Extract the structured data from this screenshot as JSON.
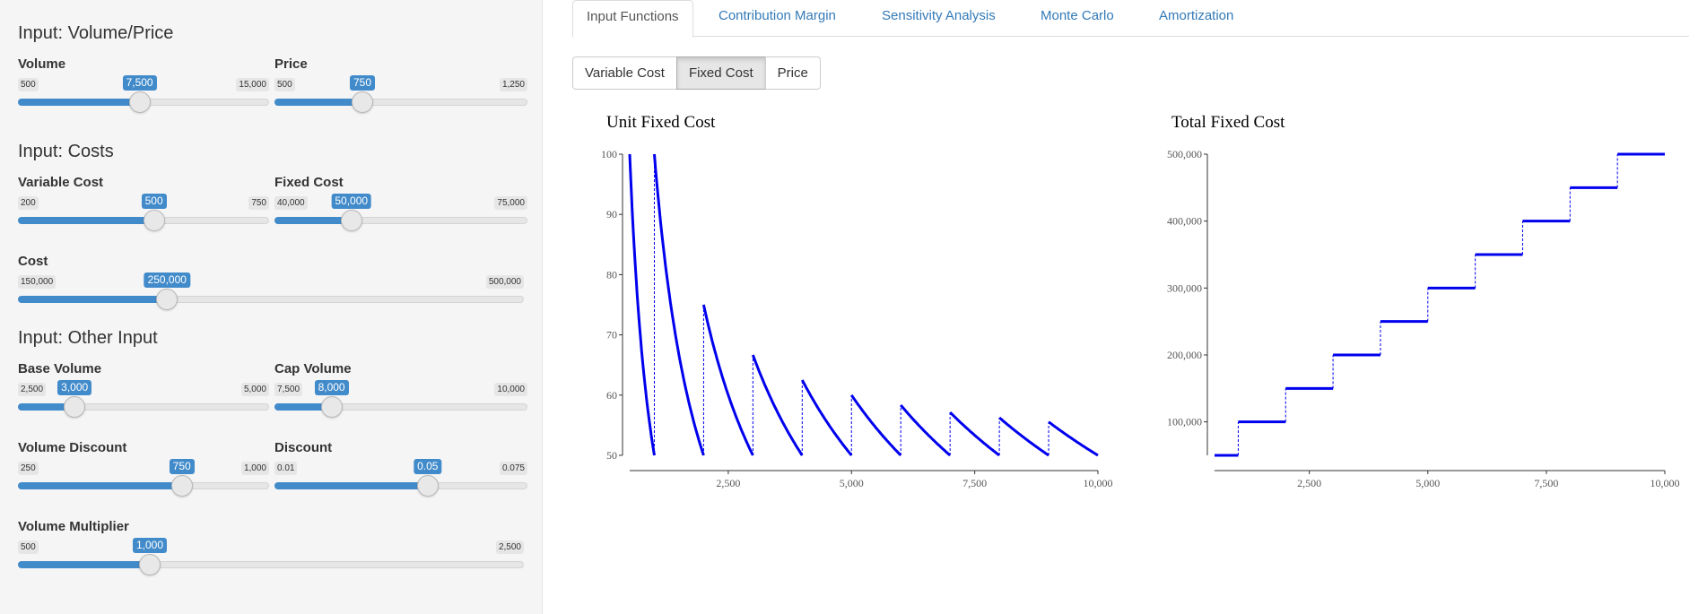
{
  "sidebar": {
    "sections": [
      {
        "title": "Input: Volume/Price"
      },
      {
        "title": "Input: Costs"
      },
      {
        "title": "Input: Other Input"
      }
    ],
    "sliders": [
      {
        "label": "Volume",
        "min_label": "500",
        "max_label": "15,000",
        "value_label": "7,500",
        "fraction": 0.4828
      },
      {
        "label": "Price",
        "min_label": "500",
        "max_label": "1,250",
        "value_label": "750",
        "fraction": 0.3333
      },
      {
        "label": "Variable Cost",
        "min_label": "200",
        "max_label": "750",
        "value_label": "500",
        "fraction": 0.5455
      },
      {
        "label": "Fixed Cost",
        "min_label": "40,000",
        "max_label": "75,000",
        "value_label": "50,000",
        "fraction": 0.2857
      },
      {
        "label": "Cost",
        "min_label": "150,000",
        "max_label": "500,000",
        "value_label": "250,000",
        "fraction": 0.2857
      },
      {
        "label": "Base Volume",
        "min_label": "2,500",
        "max_label": "5,000",
        "value_label": "3,000",
        "fraction": 0.2
      },
      {
        "label": "Cap Volume",
        "min_label": "7,500",
        "max_label": "10,000",
        "value_label": "8,000",
        "fraction": 0.2
      },
      {
        "label": "Volume Discount",
        "min_label": "250",
        "max_label": "1,000",
        "value_label": "750",
        "fraction": 0.6667
      },
      {
        "label": "Discount",
        "min_label": "0.01",
        "max_label": "0.075",
        "value_label": "0.05",
        "fraction": 0.6154
      },
      {
        "label": "Volume Multiplier",
        "min_label": "500",
        "max_label": "2,500",
        "value_label": "1,000",
        "fraction": 0.25
      }
    ]
  },
  "tabs": [
    {
      "label": "Input Functions",
      "active": true
    },
    {
      "label": "Contribution Margin",
      "active": false
    },
    {
      "label": "Sensitivity Analysis",
      "active": false
    },
    {
      "label": "Monte Carlo",
      "active": false
    },
    {
      "label": "Amortization",
      "active": false
    }
  ],
  "buttons": [
    {
      "label": "Variable Cost",
      "active": false
    },
    {
      "label": "Fixed Cost",
      "active": true
    },
    {
      "label": "Price",
      "active": false
    }
  ],
  "colors": {
    "accent": "#428bca",
    "line": "#0000ee"
  },
  "chart_data": [
    {
      "type": "line",
      "title": "Unit Fixed Cost",
      "xlabel": "",
      "ylabel": "",
      "xlim": [
        500,
        10000
      ],
      "ylim": [
        50,
        100
      ],
      "xticks": [
        2500,
        5000,
        7500,
        10000
      ],
      "xtick_labels": [
        "2,500",
        "5,000",
        "7,500",
        "10,000"
      ],
      "yticks": [
        50,
        60,
        70,
        80,
        90,
        100
      ],
      "ytick_labels": [
        "50",
        "60",
        "70",
        "80",
        "90",
        "100"
      ],
      "step_size": 50000,
      "step_width": 1000,
      "first_step_x": 1000
    },
    {
      "type": "line",
      "title": "Total Fixed Cost",
      "xlabel": "",
      "ylabel": "",
      "xlim": [
        500,
        10000
      ],
      "ylim": [
        50000,
        500000
      ],
      "xticks": [
        2500,
        5000,
        7500,
        10000
      ],
      "xtick_labels": [
        "2,500",
        "5,000",
        "7,500",
        "10,000"
      ],
      "yticks": [
        100000,
        200000,
        300000,
        400000,
        500000
      ],
      "ytick_labels": [
        "100,000",
        "200,000",
        "300,000",
        "400,000",
        "500,000"
      ],
      "x": [
        500,
        1000,
        1000,
        2000,
        2000,
        3000,
        3000,
        4000,
        4000,
        5000,
        5000,
        6000,
        6000,
        7000,
        7000,
        8000,
        8000,
        9000,
        9000,
        10000
      ],
      "y": [
        50000,
        50000,
        100000,
        100000,
        150000,
        150000,
        200000,
        200000,
        250000,
        250000,
        300000,
        300000,
        350000,
        350000,
        400000,
        400000,
        450000,
        450000,
        500000,
        500000
      ]
    }
  ]
}
